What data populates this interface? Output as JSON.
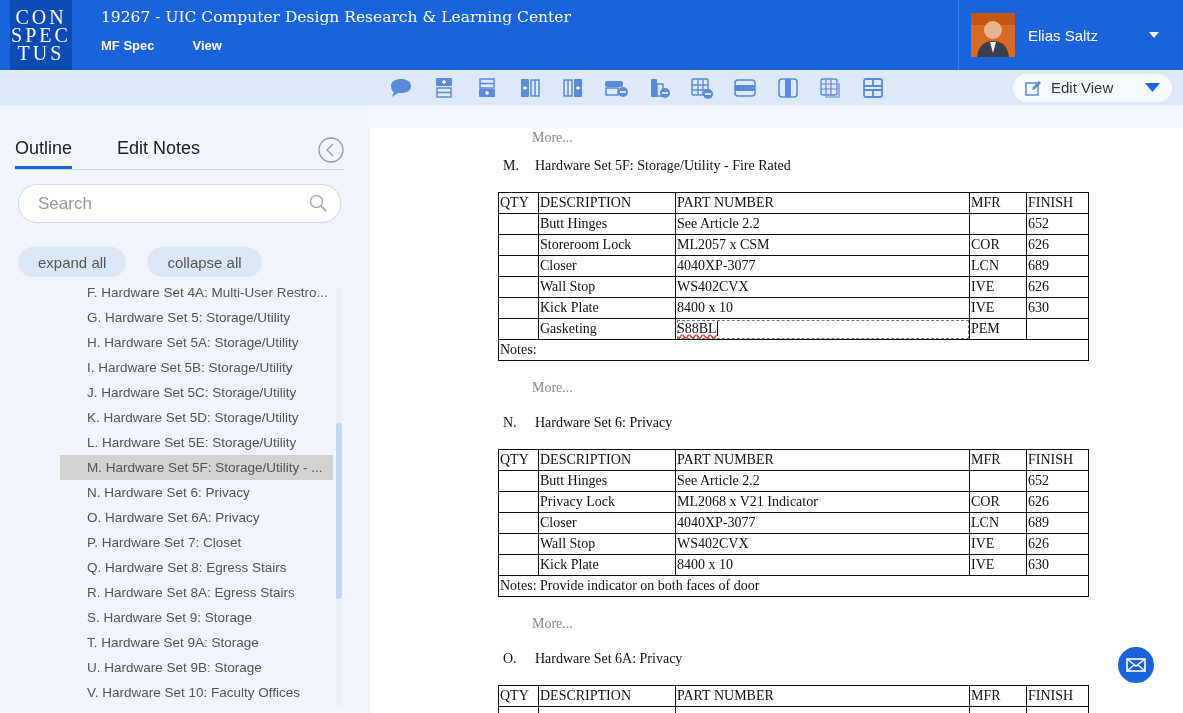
{
  "header": {
    "logo_lines": [
      "CON",
      "SPEC",
      "TUS"
    ],
    "title": "19267 - UIC Computer Design Research & Learning Center",
    "menu": [
      "MF Spec",
      "View"
    ],
    "user": {
      "name": "Elias Saltz"
    }
  },
  "toolbar": {
    "view_dropdown": "Edit View"
  },
  "sidebar": {
    "tabs": [
      {
        "label": "Outline",
        "selected": true
      },
      {
        "label": "Edit Notes",
        "selected": false
      }
    ],
    "search": {
      "placeholder": "Search"
    },
    "buttons": [
      "expand all",
      "collapse all"
    ],
    "outline": [
      {
        "label": "F. Hardware Set 4A: Multi-User Restro...",
        "selected": false
      },
      {
        "label": "G. Hardware Set 5: Storage/Utility",
        "selected": false
      },
      {
        "label": "H. Hardware Set 5A: Storage/Utility",
        "selected": false
      },
      {
        "label": "I. Hardware Set 5B: Storage/Utility",
        "selected": false
      },
      {
        "label": "J. Hardware Set 5C: Storage/Utility",
        "selected": false
      },
      {
        "label": "K. Hardware Set 5D: Storage/Utility",
        "selected": false
      },
      {
        "label": "L. Hardware Set 5E: Storage/Utility",
        "selected": false
      },
      {
        "label": "M. Hardware Set 5F: Storage/Utility - ...",
        "selected": true
      },
      {
        "label": "N. Hardware Set 6: Privacy",
        "selected": false
      },
      {
        "label": "O. Hardware Set 6A: Privacy",
        "selected": false
      },
      {
        "label": "P. Hardware Set 7: Closet",
        "selected": false
      },
      {
        "label": "Q. Hardware Set 8: Egress Stairs",
        "selected": false
      },
      {
        "label": "R. Hardware Set 8A: Egress Stairs",
        "selected": false
      },
      {
        "label": "S. Hardware Set 9: Storage",
        "selected": false
      },
      {
        "label": "T. Hardware Set 9A: Storage",
        "selected": false
      },
      {
        "label": "U. Hardware Set 9B: Storage",
        "selected": false
      },
      {
        "label": "V. Hardware Set 10: Faculty Offices",
        "selected": false
      }
    ]
  },
  "document": {
    "blocks": [
      {
        "kind": "more",
        "text": "More..."
      },
      {
        "kind": "heading",
        "letter": "M.",
        "title": "Hardware Set 5F: Storage/Utility - Fire Rated"
      },
      {
        "kind": "table",
        "columns": [
          "QTY",
          "DESCRIPTION",
          "PART NUMBER",
          "MFR",
          "FINISH"
        ],
        "rows": [
          {
            "cells": [
              "",
              "Butt Hinges",
              "See Article 2.2",
              "",
              "652"
            ],
            "editing": false
          },
          {
            "cells": [
              "",
              "Storeroom Lock",
              "ML2057 x CSM",
              "COR",
              "626"
            ],
            "editing": false
          },
          {
            "cells": [
              "",
              "Closer",
              "4040XP-3077",
              "LCN",
              "689"
            ],
            "editing": false
          },
          {
            "cells": [
              "",
              "Wall Stop",
              "WS402CVX",
              "IVE",
              "626"
            ],
            "editing": false
          },
          {
            "cells": [
              "",
              "Kick Plate",
              "8400 x 10",
              "IVE",
              "630"
            ],
            "editing": false
          },
          {
            "cells": [
              "",
              "Gasketing",
              "S88BL",
              "PEM",
              ""
            ],
            "editing": true
          }
        ],
        "notes": "Notes:"
      },
      {
        "kind": "more",
        "text": "More..."
      },
      {
        "kind": "heading",
        "letter": "N.",
        "title": "Hardware Set 6: Privacy"
      },
      {
        "kind": "table",
        "columns": [
          "QTY",
          "DESCRIPTION",
          "PART NUMBER",
          "MFR",
          "FINISH"
        ],
        "rows": [
          {
            "cells": [
              "",
              "Butt Hinges",
              "See Article 2.2",
              "",
              "652"
            ],
            "editing": false
          },
          {
            "cells": [
              "",
              "Privacy Lock",
              "ML2068 x V21 Indicator",
              "COR",
              "626"
            ],
            "editing": false
          },
          {
            "cells": [
              "",
              "Closer",
              "4040XP-3077",
              "LCN",
              "689"
            ],
            "editing": false
          },
          {
            "cells": [
              "",
              "Wall Stop",
              "WS402CVX",
              "IVE",
              "626"
            ],
            "editing": false
          },
          {
            "cells": [
              "",
              "Kick Plate",
              "8400 x 10",
              "IVE",
              "630"
            ],
            "editing": false
          }
        ],
        "notes": "Notes: Provide indicator on both faces of door"
      },
      {
        "kind": "more",
        "text": "More..."
      },
      {
        "kind": "heading",
        "letter": "O.",
        "title": "Hardware Set 6A: Privacy"
      },
      {
        "kind": "table",
        "columns": [
          "QTY",
          "DESCRIPTION",
          "PART NUMBER",
          "MFR",
          "FINISH"
        ]
      }
    ]
  }
}
